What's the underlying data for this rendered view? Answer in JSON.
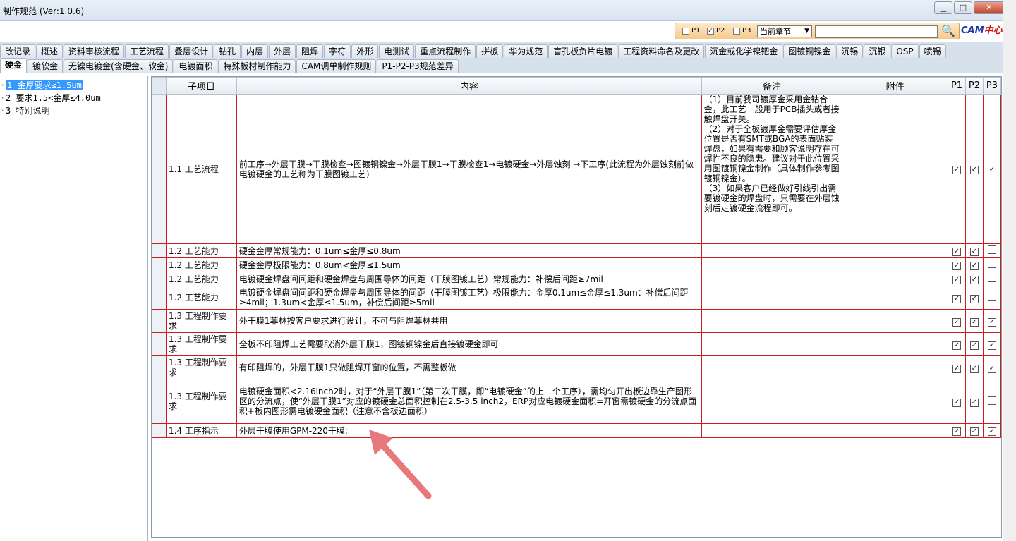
{
  "window": {
    "title": "制作规范 (Ver:1.0.6)",
    "minimize": "▁",
    "maximize": "□",
    "close": "✕"
  },
  "search": {
    "p1_label": "P1",
    "p2_label": "P2",
    "p3_label": "P3",
    "p1_checked": false,
    "p2_checked": true,
    "p3_checked": false,
    "chapter_value": "当前章节",
    "query": ""
  },
  "logo": {
    "cam": "CAM",
    "center": "中心"
  },
  "tabs_row1": [
    "改记录",
    "概述",
    "资料审核流程",
    "工艺流程",
    "叠层设计",
    "钻孔",
    "内层",
    "外层",
    "阻焊",
    "字符",
    "外形",
    "电测试",
    "重点流程制作",
    "拼板",
    "华为规范",
    "盲孔板负片电镀",
    "工程资料命名及更改",
    "沉金或化学镍钯金",
    "图镀铜镍金",
    "沉锡",
    "沉银",
    "OSP",
    "喷锡"
  ],
  "tabs_row2": [
    "硬金",
    "镀软金",
    "无镍电镀金(含硬金、软金)",
    "电镀面积",
    "特殊板材制作能力",
    "CAM调单制作规则",
    "P1-P2-P3规范差异"
  ],
  "tree": [
    {
      "label": "1 金厚要求≤1.5um",
      "selected": true
    },
    {
      "label": "2 要求1.5<金厚≤4.0um",
      "selected": false
    },
    {
      "label": "3 特别说明",
      "selected": false
    }
  ],
  "grid": {
    "headers": {
      "sub": "子项目",
      "content": "内容",
      "note": "备注",
      "attach": "附件",
      "p1": "P1",
      "p2": "P2",
      "p3": "P3"
    },
    "rows": [
      {
        "sub": "1.1 工艺流程",
        "content": "前工序→外层干膜→干膜检查→图镀铜镍金→外层干膜1→干膜检查1→电镀硬金→外层蚀刻 →下工序(此流程为外层蚀刻前做电镀硬金的工艺称为干膜图镀工艺)",
        "note": "（1）目前我司镀厚金采用金钴合金，此工艺一般用于PCB插头或者接触焊盘开关。\n（2）对于全板镀厚金需要评估厚金位置是否有SMT或BGA的表面贴装焊盘，如果有需要和顾客说明存在可焊性不良的隐患。建议对于此位置采用图镀铜镍金制作（具体制作参考图镀铜镍金）。\n（3）如果客户已经做好引线引出需要镀硬金的焊盘时，只需要在外层蚀刻后走镀硬金流程即可。",
        "p1": true,
        "p2": true,
        "p3": true
      },
      {
        "sub": "1.2 工艺能力",
        "content": "硬金金厚常规能力：0.1um≤金厚≤0.8um",
        "note": "",
        "p1": true,
        "p2": true,
        "p3": false
      },
      {
        "sub": "1.2 工艺能力",
        "content": "硬金金厚极限能力：0.8um<金厚≤1.5um",
        "note": "",
        "p1": true,
        "p2": true,
        "p3": false
      },
      {
        "sub": "1.2 工艺能力",
        "content": "电镀硬金焊盘间间距和硬金焊盘与周围导体的间距（干膜图镀工艺）常规能力：补偿后间距≥7mil",
        "note": "",
        "p1": true,
        "p2": true,
        "p3": false
      },
      {
        "sub": "1.2 工艺能力",
        "content": "电镀硬金焊盘间间距和硬金焊盘与周围导体的间距（干膜图镀工艺）极限能力：金厚0.1um≤金厚≤1.3um：补偿后间距≥4mil；1.3um<金厚≤1.5um，补偿后间距≥5mil",
        "note": "",
        "p1": true,
        "p2": true,
        "p3": false
      },
      {
        "sub": "1.3 工程制作要求",
        "content": "外干膜1菲林按客户要求进行设计，不可与阻焊菲林共用",
        "note": "",
        "p1": true,
        "p2": true,
        "p3": true
      },
      {
        "sub": "1.3 工程制作要求",
        "content": "全板不印阻焊工艺需要取消外层干膜1，图镀铜镍金后直接镀硬金即可",
        "note": "",
        "p1": true,
        "p2": true,
        "p3": true
      },
      {
        "sub": "1.3 工程制作要求",
        "content": "有印阻焊的，外层干膜1只做阻焊开窗的位置，不需整板做",
        "note": "",
        "p1": true,
        "p2": true,
        "p3": true
      },
      {
        "sub": "1.3 工程制作要求",
        "content": "电镀硬金面积<2.16inch2时，对于“外层干膜1”（第二次干膜，即“电镀硬金”的上一个工序），需均匀开出板边靠生产图形区的分流点，使“外层干膜1”对应的镀硬金总面积控制在2.5-3.5 inch2，ERP对应电镀硬金面积=开窗需镀硬金的分流点面积+板内图形需电镀硬金面积（注意不含板边面积）",
        "note": "",
        "p1": true,
        "p2": true,
        "p3": false
      },
      {
        "sub": "1.4 工序指示",
        "content": "外层干膜使用GPM-220干膜;",
        "note": "",
        "p1": true,
        "p2": true,
        "p3": true
      }
    ]
  },
  "colors": {
    "grid_border": "#c81e1e",
    "selection": "#3399ff",
    "arrow": "#e8787c"
  }
}
